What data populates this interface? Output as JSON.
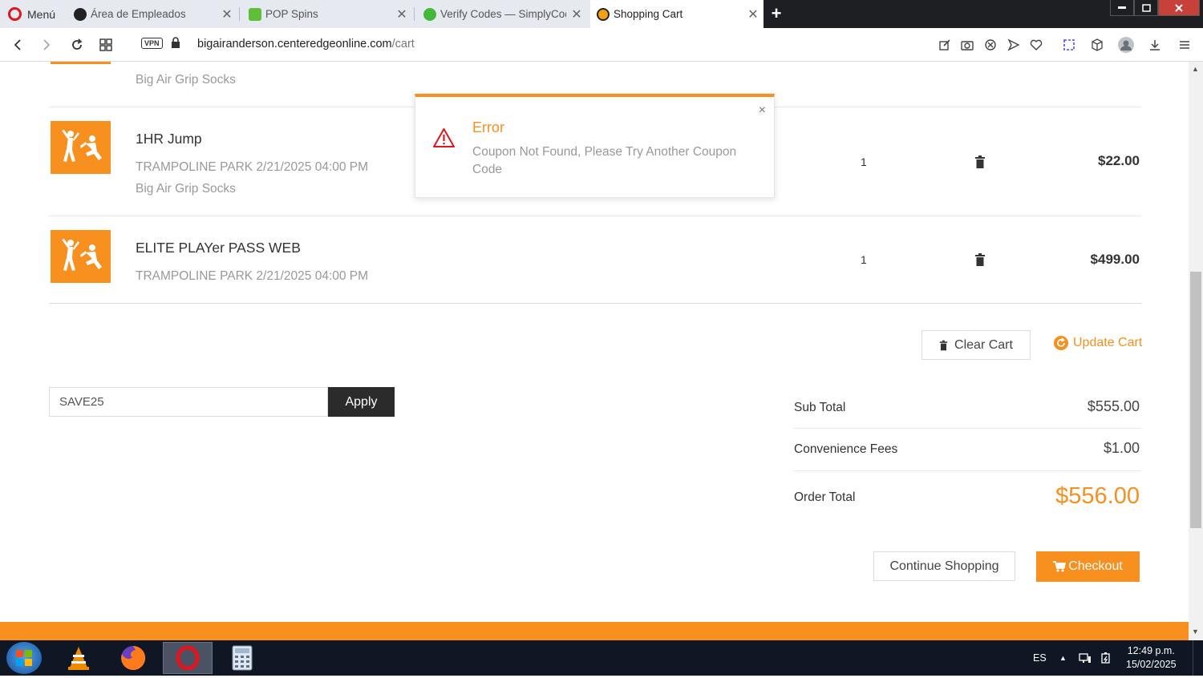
{
  "browser": {
    "menu_label": "Menú",
    "tabs": [
      {
        "title": "Área de Empleados",
        "close": "✕"
      },
      {
        "title": "POP Spins",
        "close": "✕"
      },
      {
        "title": "Verify Codes — SimplyCodes",
        "close": "✕"
      },
      {
        "title": "Shopping Cart",
        "close": "✕"
      }
    ],
    "new_tab": "+",
    "vpn_label": "VPN",
    "url_host": "bigairanderson.centeredgeonline.com",
    "url_path": "/cart"
  },
  "cart": {
    "partial_item": {
      "addon": "Big Air Grip Socks"
    },
    "items": [
      {
        "name": "1HR Jump",
        "meta": "TRAMPOLINE PARK 2/21/2025 04:00 PM",
        "addon": "Big Air Grip Socks",
        "qty": "1",
        "price": "$22.00"
      },
      {
        "name": "ELITE PLAYer PASS WEB",
        "meta": "TRAMPOLINE PARK 2/21/2025 04:00 PM",
        "qty": "1",
        "price": "$499.00"
      }
    ],
    "clear_label": "Clear Cart",
    "update_label": "Update Cart",
    "coupon_value": "SAVE25",
    "apply_label": "Apply",
    "summary": {
      "subtotal_label": "Sub Total",
      "subtotal_value": "$555.00",
      "fees_label": "Convenience Fees",
      "fees_value": "$1.00",
      "total_label": "Order Total",
      "total_value": "$556.00"
    },
    "continue_label": "Continue Shopping",
    "checkout_label": "Checkout"
  },
  "toast": {
    "title": "Error",
    "message": "Coupon Not Found, Please Try Another Coupon Code",
    "close": "×"
  },
  "taskbar": {
    "lang": "ES",
    "time": "12:49 p.m.",
    "date": "15/02/2025"
  },
  "colors": {
    "accent": "#f7901e",
    "error_icon": "#e0151d"
  }
}
